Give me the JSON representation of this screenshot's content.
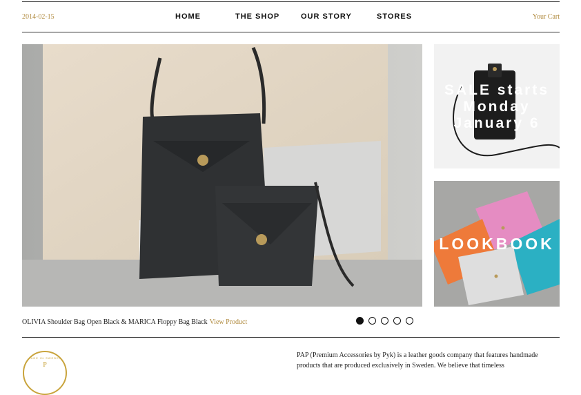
{
  "header": {
    "date": "2014-02-15",
    "nav": [
      "HOME",
      "THE SHOP",
      "OUR STORY",
      "STORES"
    ],
    "cart_label": "Your Cart"
  },
  "hero": {
    "caption": "OLIVIA Shoulder Bag Open Black & MARICA Floppy Bag Black",
    "link_label": "View Product",
    "slide_count": 5,
    "active_slide": 1
  },
  "promo": {
    "sale_lines": [
      "SALE starts",
      "Monday",
      "January 6"
    ],
    "lookbook_label": "LOOKBOOK"
  },
  "badge": {
    "text": "MADE IN SWEDEN",
    "letter": "P"
  },
  "about": {
    "text": "PAP (Premium Accessories by Pyk) is a leather goods company that features handmade products that are produced exclusively in Sweden. We believe that timeless"
  },
  "colors": {
    "accent": "#b08a3e",
    "rule": "#333333",
    "badge": "#c9a43c"
  }
}
